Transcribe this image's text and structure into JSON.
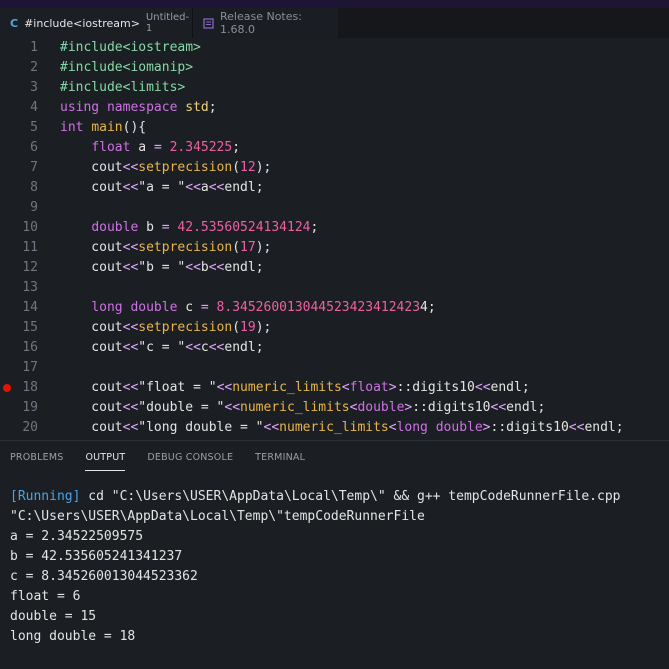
{
  "tabs": [
    {
      "icon": "C",
      "name": "#include<iostream>",
      "sub": "Untitled-1"
    },
    {
      "name": "Release Notes: 1.68.0"
    }
  ],
  "editor": {
    "breakpoint_line": "18",
    "lines": [
      {
        "n": "1",
        "tokens": [
          [
            "inc",
            "#include<iostream>"
          ]
        ]
      },
      {
        "n": "2",
        "tokens": [
          [
            "inc",
            "#include<iomanip>"
          ]
        ]
      },
      {
        "n": "3",
        "tokens": [
          [
            "inc",
            "#include<limits>"
          ]
        ]
      },
      {
        "n": "4",
        "tokens": [
          [
            "kw",
            "using "
          ],
          [
            "kw",
            "namespace "
          ],
          [
            "std",
            "std"
          ],
          [
            "plain",
            ";"
          ]
        ]
      },
      {
        "n": "5",
        "tokens": [
          [
            "kw",
            "int "
          ],
          [
            "fn",
            "main"
          ],
          [
            "plain",
            "(){"
          ]
        ]
      },
      {
        "n": "6",
        "tokens": [
          [
            "plain",
            "    "
          ],
          [
            "kw",
            "float "
          ],
          [
            "plain",
            "a "
          ],
          [
            "op",
            "= "
          ],
          [
            "num",
            "2.345225"
          ],
          [
            "plain",
            ";"
          ]
        ]
      },
      {
        "n": "7",
        "tokens": [
          [
            "plain",
            "    cout"
          ],
          [
            "op",
            "<<"
          ],
          [
            "fn",
            "setprecision"
          ],
          [
            "plain",
            "("
          ],
          [
            "num",
            "12"
          ],
          [
            "plain",
            ");"
          ]
        ]
      },
      {
        "n": "8",
        "tokens": [
          [
            "plain",
            "    cout"
          ],
          [
            "op",
            "<<"
          ],
          [
            "str",
            "\"a = \""
          ],
          [
            "op",
            "<<"
          ],
          [
            "plain",
            "a"
          ],
          [
            "op",
            "<<"
          ],
          [
            "plain",
            "endl;"
          ]
        ]
      },
      {
        "n": "9",
        "tokens": []
      },
      {
        "n": "10",
        "tokens": [
          [
            "plain",
            "    "
          ],
          [
            "kw",
            "double "
          ],
          [
            "plain",
            "b "
          ],
          [
            "op",
            "= "
          ],
          [
            "num",
            "42.53560524134124"
          ],
          [
            "plain",
            ";"
          ]
        ]
      },
      {
        "n": "11",
        "tokens": [
          [
            "plain",
            "    cout"
          ],
          [
            "op",
            "<<"
          ],
          [
            "fn",
            "setprecision"
          ],
          [
            "plain",
            "("
          ],
          [
            "num",
            "17"
          ],
          [
            "plain",
            ");"
          ]
        ]
      },
      {
        "n": "12",
        "tokens": [
          [
            "plain",
            "    cout"
          ],
          [
            "op",
            "<<"
          ],
          [
            "str",
            "\"b = \""
          ],
          [
            "op",
            "<<"
          ],
          [
            "plain",
            "b"
          ],
          [
            "op",
            "<<"
          ],
          [
            "plain",
            "endl;"
          ]
        ]
      },
      {
        "n": "13",
        "tokens": []
      },
      {
        "n": "14",
        "tokens": [
          [
            "plain",
            "    "
          ],
          [
            "kw",
            "long double "
          ],
          [
            "plain",
            "c "
          ],
          [
            "op",
            "= "
          ],
          [
            "num",
            "8.345260013044523423412423"
          ],
          [
            "plain",
            "4;"
          ]
        ]
      },
      {
        "n": "15",
        "tokens": [
          [
            "plain",
            "    cout"
          ],
          [
            "op",
            "<<"
          ],
          [
            "fn",
            "setprecision"
          ],
          [
            "plain",
            "("
          ],
          [
            "num",
            "19"
          ],
          [
            "plain",
            ");"
          ]
        ]
      },
      {
        "n": "16",
        "tokens": [
          [
            "plain",
            "    cout"
          ],
          [
            "op",
            "<<"
          ],
          [
            "str",
            "\"c = \""
          ],
          [
            "op",
            "<<"
          ],
          [
            "plain",
            "c"
          ],
          [
            "op",
            "<<"
          ],
          [
            "plain",
            "endl;"
          ]
        ]
      },
      {
        "n": "17",
        "tokens": []
      },
      {
        "n": "18",
        "tokens": [
          [
            "plain",
            "    cout"
          ],
          [
            "op",
            "<<"
          ],
          [
            "str",
            "\"float = \""
          ],
          [
            "op",
            "<<"
          ],
          [
            "fn",
            "numeric_limits"
          ],
          [
            "op",
            "<"
          ],
          [
            "kw",
            "float"
          ],
          [
            "op",
            ">"
          ],
          [
            "plain",
            "::digits10"
          ],
          [
            "op",
            "<<"
          ],
          [
            "plain",
            "endl;"
          ]
        ]
      },
      {
        "n": "19",
        "tokens": [
          [
            "plain",
            "    cout"
          ],
          [
            "op",
            "<<"
          ],
          [
            "str",
            "\"double = \""
          ],
          [
            "op",
            "<<"
          ],
          [
            "fn",
            "numeric_limits"
          ],
          [
            "op",
            "<"
          ],
          [
            "kw",
            "double"
          ],
          [
            "op",
            ">"
          ],
          [
            "plain",
            "::digits10"
          ],
          [
            "op",
            "<<"
          ],
          [
            "plain",
            "endl;"
          ]
        ]
      },
      {
        "n": "20",
        "tokens": [
          [
            "plain",
            "    cout"
          ],
          [
            "op",
            "<<"
          ],
          [
            "str",
            "\"long double = \""
          ],
          [
            "op",
            "<<"
          ],
          [
            "fn",
            "numeric_limits"
          ],
          [
            "op",
            "<"
          ],
          [
            "kw",
            "long double"
          ],
          [
            "op",
            ">"
          ],
          [
            "plain",
            "::digits10"
          ],
          [
            "op",
            "<<"
          ],
          [
            "plain",
            "endl;"
          ]
        ]
      }
    ]
  },
  "panel": {
    "tabs": [
      "PROBLEMS",
      "OUTPUT",
      "DEBUG CONSOLE",
      "TERMINAL"
    ],
    "active": "OUTPUT",
    "running_tag": "[Running]",
    "command": " cd \"C:\\Users\\USER\\AppData\\Local\\Temp\\\" && g++ tempCodeRunnerFile.cpp",
    "command_cont": "\"C:\\Users\\USER\\AppData\\Local\\Temp\\\"tempCodeRunnerFile",
    "output_lines": [
      "a = 2.34522509575",
      "b = 42.535605241341237",
      "c = 8.345260013044523362",
      "float = 6",
      "double = 15",
      "long double = 18"
    ]
  },
  "colors": {
    "background": "#1b1f23",
    "keyword": "#cf71e6",
    "include": "#86d9a8",
    "number": "#ef5fa6",
    "function": "#e7b54a",
    "running": "#4aa3e8",
    "breakpoint": "#e51400"
  }
}
